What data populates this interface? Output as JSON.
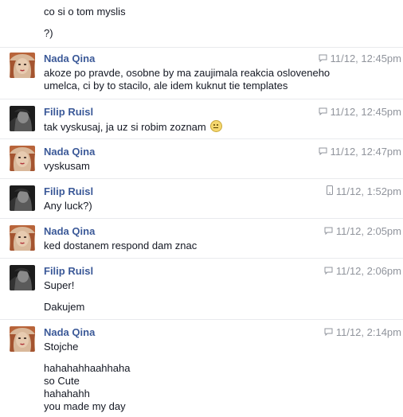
{
  "messages": [
    {
      "sender": "",
      "time": "",
      "lines": [
        "co si o tom myslis",
        "?)"
      ]
    },
    {
      "sender": "Nada Qina",
      "time": "11/12, 12:45pm",
      "device": "chat-icon",
      "lines": [
        "akoze po pravde, osobne by ma zaujimala reakcia osloveneho",
        "umelca, ci by to stacilo, ale idem kuknut tie templates"
      ]
    },
    {
      "sender": "Filip Ruisl",
      "time": "11/12, 12:45pm",
      "device": "chat-icon",
      "lines": [
        "tak vyskusaj, ja uz si robim zoznam"
      ]
    },
    {
      "sender": "Nada Qina",
      "time": "11/12, 12:47pm",
      "device": "chat-icon",
      "lines": [
        "vyskusam"
      ]
    },
    {
      "sender": "Filip Ruisl",
      "time": "11/12, 1:52pm",
      "device": "mobile-icon",
      "lines": [
        "Any luck?)"
      ]
    },
    {
      "sender": "Nada Qina",
      "time": "11/12, 2:05pm",
      "device": "chat-icon",
      "lines": [
        "ked dostanem respond dam znac"
      ]
    },
    {
      "sender": "Filip Ruisl",
      "time": "11/12, 2:06pm",
      "device": "chat-icon",
      "lines": [
        "Super!",
        "Dakujem"
      ]
    },
    {
      "sender": "Nada Qina",
      "time": "11/12, 2:14pm",
      "device": "chat-icon",
      "lines": [
        "Stojche",
        "hahahahhaahhaha",
        "so Cute",
        "hahahahh",
        "you made my day"
      ]
    }
  ],
  "colors": {
    "sender": "#3b5998",
    "meta": "#90949c",
    "text": "#141823",
    "divider": "#e9eaed"
  }
}
